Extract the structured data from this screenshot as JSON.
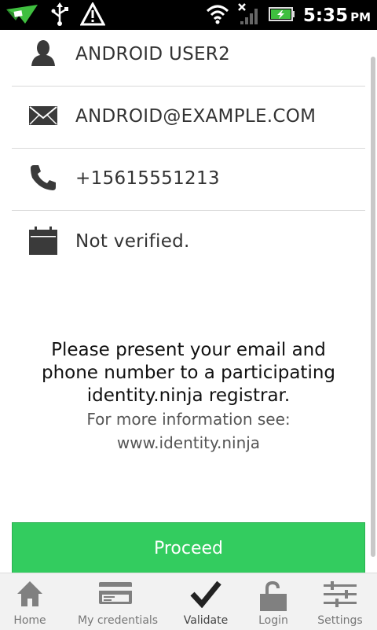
{
  "statusbar": {
    "time": "5:35",
    "ampm": "PM"
  },
  "profile": {
    "name": "ANDROID USER2",
    "email": "ANDROID@EXAMPLE.COM",
    "phone": "+15615551213",
    "verification": "Not verified."
  },
  "info": {
    "line1": "Please present your email and",
    "line2": "phone number to a participating",
    "line3": "identity.ninja registrar.",
    "more": "For more information see:",
    "url": "www.identity.ninja"
  },
  "proceed_label": "Proceed",
  "nav": {
    "home": "Home",
    "credentials": "My credentials",
    "validate": "Validate",
    "login": "Login",
    "settings": "Settings",
    "active": "validate"
  },
  "colors": {
    "accent": "#33cc5f",
    "icon": "#3a3a3a"
  }
}
